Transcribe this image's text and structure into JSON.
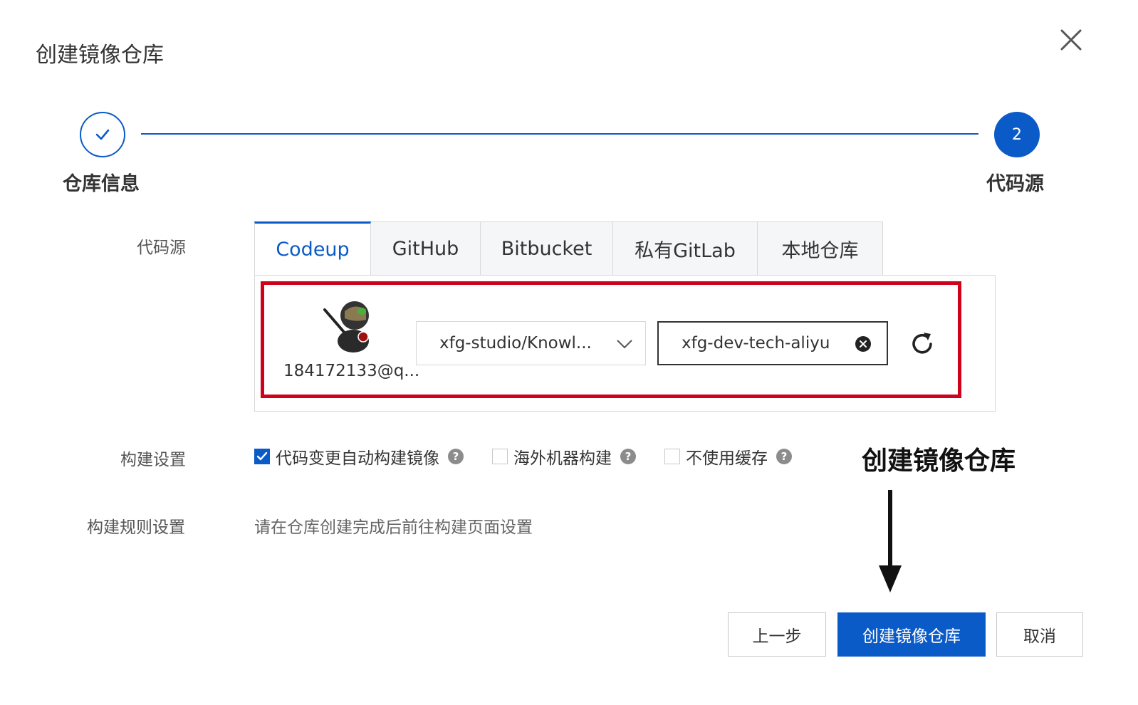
{
  "dialog": {
    "title": "创建镜像仓库"
  },
  "steps": [
    {
      "label": "仓库信息",
      "status": "completed"
    },
    {
      "number": "2",
      "label": "代码源",
      "status": "current"
    }
  ],
  "form": {
    "source_label": "代码源",
    "build_settings_label": "构建设置",
    "build_rules_label": "构建规则设置",
    "build_rules_text": "请在仓库创建完成后前往构建页面设置"
  },
  "tabs": [
    {
      "label": "Codeup",
      "active": true
    },
    {
      "label": "GitHub",
      "active": false
    },
    {
      "label": "Bitbucket",
      "active": false
    },
    {
      "label": "私有GitLab",
      "active": false
    },
    {
      "label": "本地仓库",
      "active": false
    }
  ],
  "source": {
    "account": "184172133@q...",
    "repo_select": "xfg-studio/Knowl...",
    "branch_value": "xfg-dev-tech-aliyu"
  },
  "build_options": [
    {
      "label": "代码变更自动构建镜像",
      "checked": true
    },
    {
      "label": "海外机器构建",
      "checked": false
    },
    {
      "label": "不使用缓存",
      "checked": false
    }
  ],
  "help_glyph": "?",
  "annotation": {
    "text": "创建镜像仓库"
  },
  "buttons": {
    "prev": "上一步",
    "create": "创建镜像仓库",
    "cancel": "取消"
  },
  "colors": {
    "primary": "#0a5bc8",
    "highlight": "#d0021b"
  },
  "icons": [
    "close-icon",
    "check-icon",
    "chevron-down-icon",
    "clear-icon",
    "refresh-icon",
    "help-icon",
    "arrow-down-icon"
  ]
}
